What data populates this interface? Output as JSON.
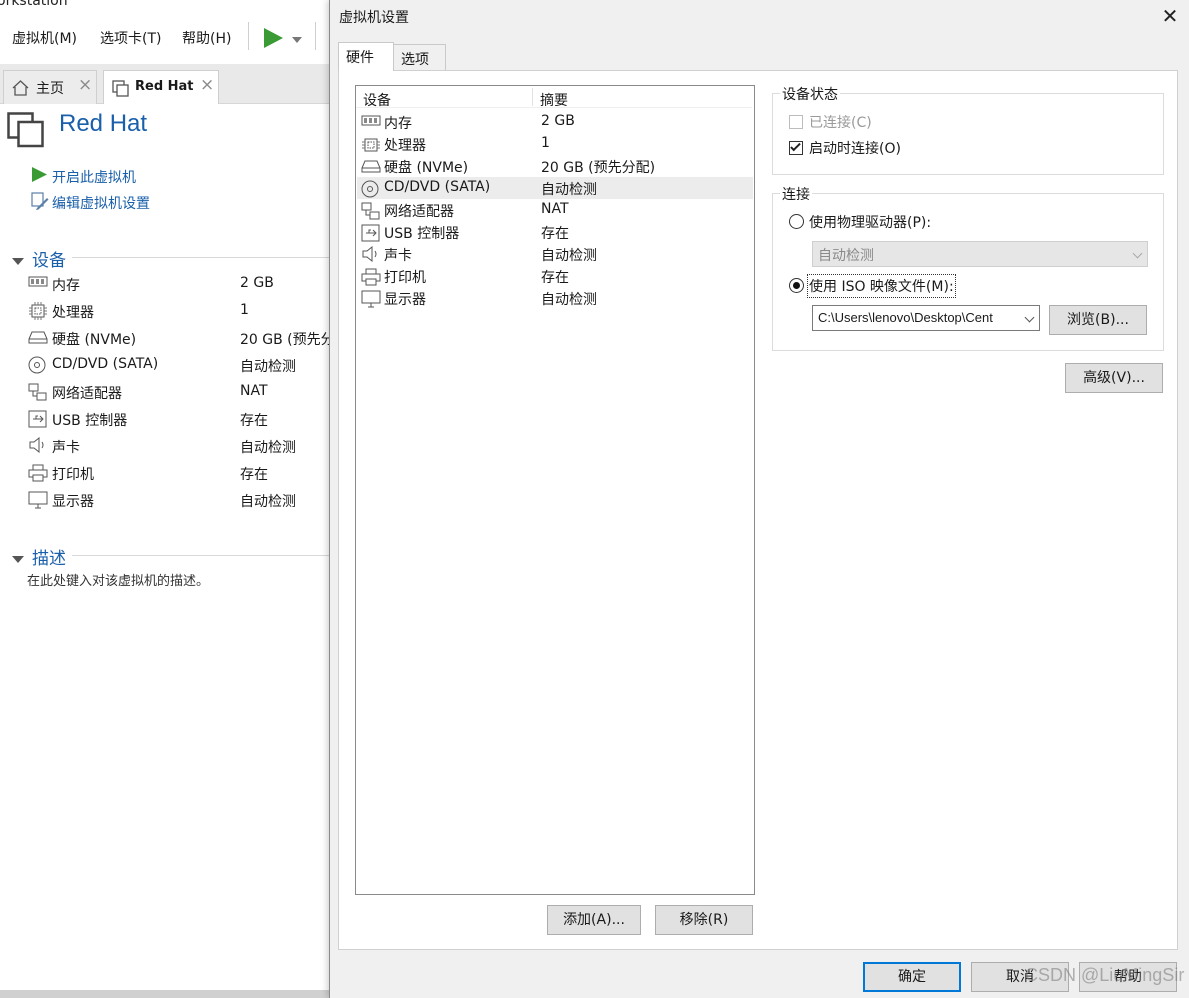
{
  "main_window": {
    "title_fragment": "orkstation",
    "menu": {
      "vm": "虚拟机(M)",
      "tabs": "选项卡(T)",
      "help": "帮助(H)"
    },
    "tabs": [
      {
        "label": "主页"
      },
      {
        "label": "Red Hat"
      }
    ],
    "vm_name": "Red Hat",
    "actions": {
      "power_on": "开启此虚拟机",
      "edit_settings": "编辑虚拟机设置"
    },
    "devices_section": "设备",
    "devices": [
      {
        "name": "内存",
        "value": "2 GB"
      },
      {
        "name": "处理器",
        "value": "1"
      },
      {
        "name": "硬盘 (NVMe)",
        "value": "20 GB (预先分"
      },
      {
        "name": "CD/DVD (SATA)",
        "value": "自动检测"
      },
      {
        "name": "网络适配器",
        "value": "NAT"
      },
      {
        "name": "USB 控制器",
        "value": "存在"
      },
      {
        "name": "声卡",
        "value": "自动检测"
      },
      {
        "name": "打印机",
        "value": "存在"
      },
      {
        "name": "显示器",
        "value": "自动检测"
      }
    ],
    "description_section": "描述",
    "description_placeholder": "在此处键入对该虚拟机的描述。"
  },
  "dialog": {
    "title": "虚拟机设置",
    "close": "✕",
    "tabs": {
      "hardware": "硬件",
      "options": "选项"
    },
    "list_headers": {
      "device": "设备",
      "summary": "摘要"
    },
    "list": [
      {
        "name": "内存",
        "value": "2 GB"
      },
      {
        "name": "处理器",
        "value": "1"
      },
      {
        "name": "硬盘 (NVMe)",
        "value": "20 GB (预先分配)"
      },
      {
        "name": "CD/DVD (SATA)",
        "value": "自动检测"
      },
      {
        "name": "网络适配器",
        "value": "NAT"
      },
      {
        "name": "USB 控制器",
        "value": "存在"
      },
      {
        "name": "声卡",
        "value": "自动检测"
      },
      {
        "name": "打印机",
        "value": "存在"
      },
      {
        "name": "显示器",
        "value": "自动检测"
      }
    ],
    "add_button": "添加(A)...",
    "remove_button": "移除(R)",
    "device_status": {
      "title": "设备状态",
      "connected": "已连接(C)",
      "connect_on_power": "启动时连接(O)"
    },
    "connection": {
      "title": "连接",
      "physical": "使用物理驱动器(P):",
      "physical_value": "自动检测",
      "iso": "使用 ISO 映像文件(M):",
      "iso_path": "C:\\Users\\lenovo\\Desktop\\Cent",
      "browse": "浏览(B)..."
    },
    "advanced_button": "高级(V)...",
    "ok_button": "确定",
    "cancel_button": "取消",
    "help_button": "帮助"
  },
  "watermark": "CSDN @LiuMingSir"
}
